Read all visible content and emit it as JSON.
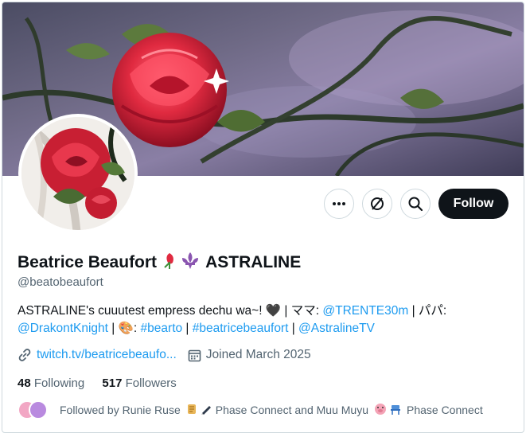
{
  "profile": {
    "name": "Beatrice Beaufort",
    "name_suffix": "ASTRALINE",
    "handle": "@beatobeaufort",
    "name_emojis": [
      "rose-bud-icon",
      "fleur-de-lis-icon"
    ]
  },
  "actions": {
    "more_icon": "more-icon",
    "grok_icon": "grok-icon",
    "search_icon": "search-icon",
    "follow_label": "Follow"
  },
  "bio": {
    "line1_text": "ASTRALINE's cuuutest empress dechu wa~! ",
    "heart": "🖤",
    "sep1": " | ママ: ",
    "mama_link": "@TRENTE30m",
    "sep2": " | パパ:",
    "papa_link": "@DrakontKnight",
    "sep3": " | ",
    "palette": "🎨",
    "sep4": ": ",
    "tag1": "#bearto",
    "sep5": " | ",
    "tag2": "#beatricebeaufort",
    "sep6": " | ",
    "group_link": "@AstralineTV"
  },
  "meta": {
    "website": "twitch.tv/beatricebeaufo...",
    "joined": "Joined March 2025"
  },
  "counts": {
    "following_count": "48",
    "following_label": "Following",
    "followers_count": "517",
    "followers_label": "Followers"
  },
  "followed_by": {
    "prefix": "Followed by Runie Ruse",
    "mid": "Phase Connect and Muu Muyu",
    "suffix": "Phase Connect"
  },
  "colors": {
    "accent": "#1d9bf0",
    "text": "#0f1419",
    "muted": "#536471",
    "rose": "#d6283a"
  }
}
